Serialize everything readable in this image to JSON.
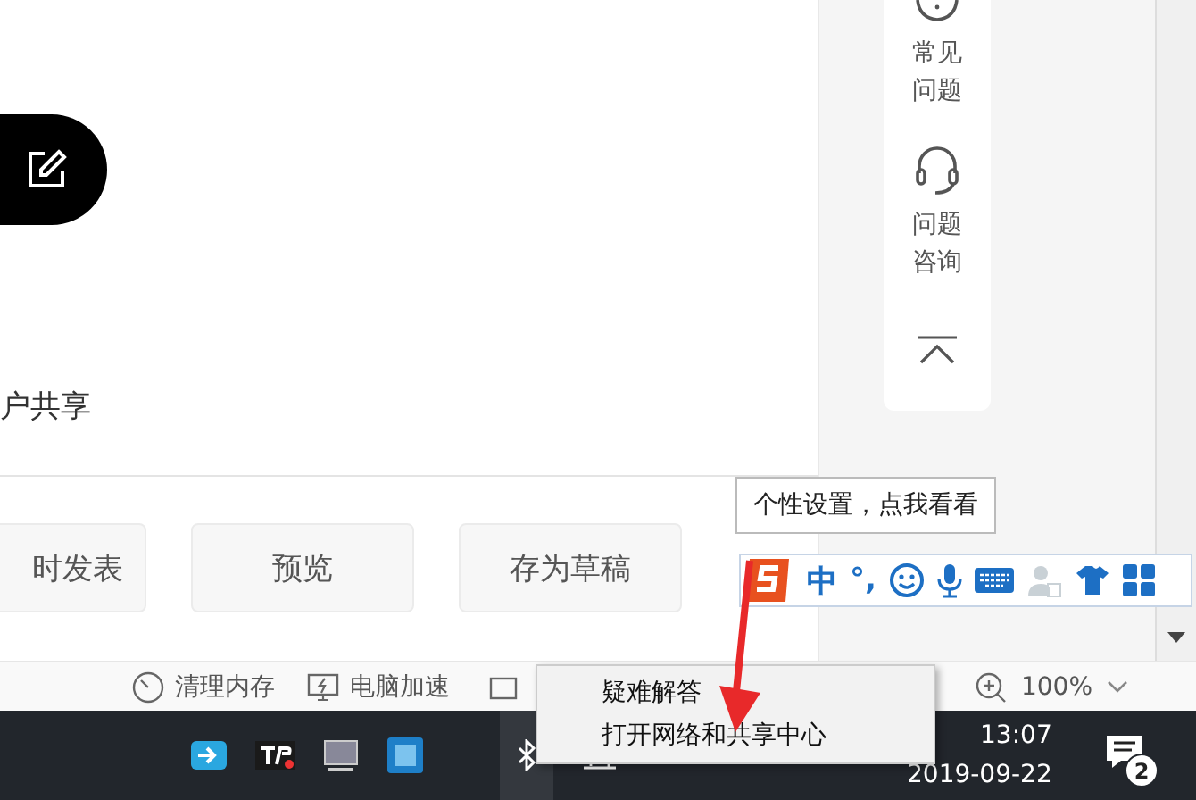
{
  "editor": {
    "partial_text": "户共享",
    "buttons": [
      {
        "label": "时发表"
      },
      {
        "label": "预览"
      },
      {
        "label": "存为草稿"
      }
    ]
  },
  "side_panel": {
    "items": [
      {
        "kind": "faq",
        "label": "常见问题"
      },
      {
        "kind": "consult",
        "label": "问题咨询"
      },
      {
        "kind": "top"
      }
    ]
  },
  "tooltip": "个性设置，点我看看",
  "ime_toolbar": {
    "items": [
      {
        "kind": "logo"
      },
      {
        "kind": "text",
        "label": "中"
      },
      {
        "kind": "text",
        "label": "°,"
      },
      {
        "kind": "emoji"
      },
      {
        "kind": "mic"
      },
      {
        "kind": "keyboard"
      },
      {
        "kind": "user",
        "disabled": true
      },
      {
        "kind": "shirt"
      },
      {
        "kind": "grid"
      }
    ]
  },
  "status_bar": {
    "items": [
      {
        "kind": "gauge",
        "label": "清理内存"
      },
      {
        "kind": "monitor",
        "label": "电脑加速"
      }
    ],
    "zoom": "100%"
  },
  "context_menu": {
    "items": [
      "疑难解答",
      "打开网络和共享中心"
    ]
  },
  "taskbar": {
    "time": "13:07",
    "date": "2019-09-22",
    "notifications": "2"
  }
}
